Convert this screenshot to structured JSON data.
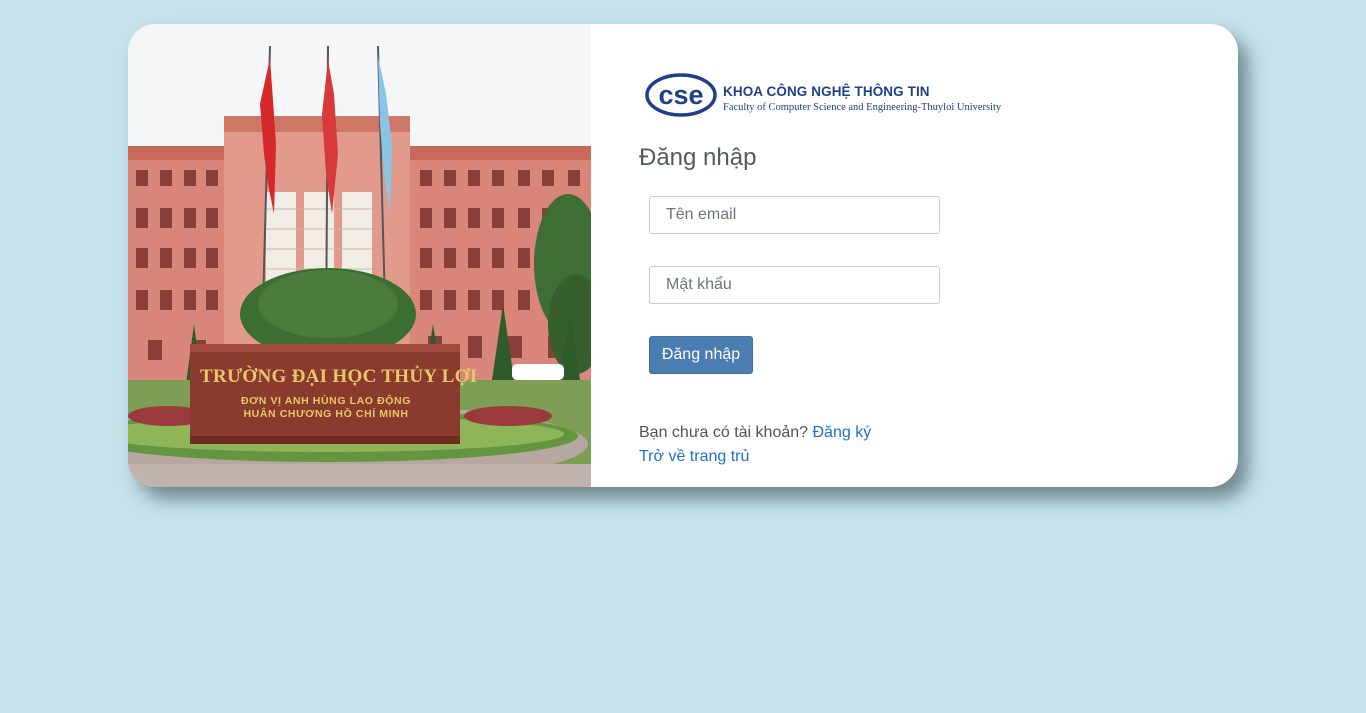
{
  "brand": {
    "logo_mark": "cse",
    "title": "KHOA CÔNG NGHỆ THÔNG TIN",
    "subtitle": "Faculty of Computer Science and Engineering-Thuyloi University"
  },
  "photo": {
    "description_icon": "university-building-photo",
    "sign_title": "TRƯỜNG ĐẠI HỌC THỦY LỢI",
    "sign_line1": "ĐƠN VỊ ANH HÙNG LAO ĐỘNG",
    "sign_line2": "HUÂN CHƯƠNG HỒ CHÍ MINH"
  },
  "login": {
    "heading": "Đăng nhập",
    "email_placeholder": "Tên email",
    "email_value": "",
    "password_placeholder": "Mật khẩu",
    "password_value": "",
    "submit_label": "Đăng nhập",
    "no_account_text": "Bạn chưa có tài khoản?",
    "signup_link": "Đăng ký",
    "home_link": "Trở về trang trủ"
  },
  "colors": {
    "background": "#c6e3eb",
    "button": "#4a7db2",
    "link": "#1f6fd1",
    "brand": "#1f3f88"
  }
}
